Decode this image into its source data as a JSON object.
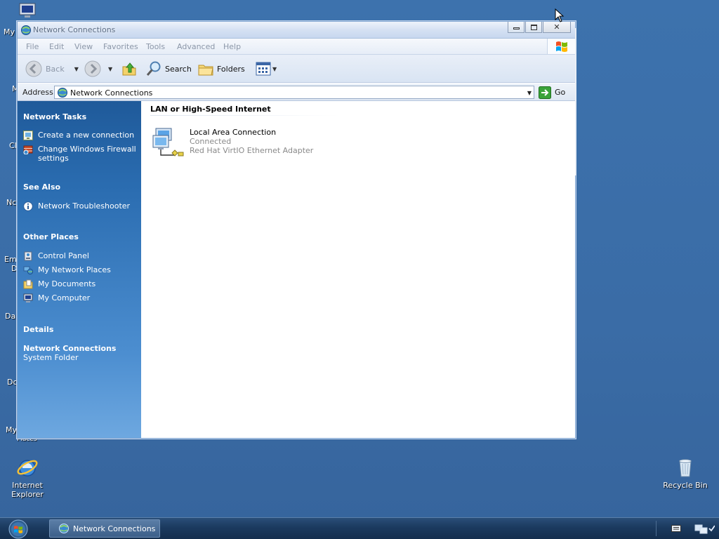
{
  "desktop": {
    "partial_labels": [
      "My",
      "M",
      "Cl",
      "Nc",
      "Em",
      "D",
      "Da",
      "Dc",
      "My",
      "Places"
    ],
    "icons": [
      {
        "label_line1": "Internet",
        "label_line2": "Explorer",
        "icon": "internet-explorer-icon"
      },
      {
        "label_line1": "Recycle Bin",
        "label_line2": "",
        "icon": "recycle-bin-icon"
      }
    ]
  },
  "window": {
    "title": "Network Connections",
    "controls": {
      "minimize": "▭",
      "maximize": "▢",
      "close": "✕"
    },
    "menu": [
      "File",
      "Edit",
      "View",
      "Favorites",
      "Tools",
      "Advanced",
      "Help"
    ],
    "toolbar": {
      "back_label": "Back",
      "search_label": "Search",
      "folders_label": "Folders"
    },
    "address": {
      "label": "Address",
      "value": "Network Connections",
      "go_label": "Go"
    }
  },
  "taskpane": {
    "network_tasks": {
      "heading": "Network Tasks",
      "items": [
        {
          "label": "Create a new connection",
          "icon": "new-connection-icon"
        },
        {
          "label": "Change Windows Firewall settings",
          "icon": "firewall-icon"
        }
      ]
    },
    "see_also": {
      "heading": "See Also",
      "items": [
        {
          "label": "Network Troubleshooter",
          "icon": "info-icon"
        }
      ]
    },
    "other_places": {
      "heading": "Other Places",
      "items": [
        {
          "label": "Control Panel",
          "icon": "control-panel-icon"
        },
        {
          "label": "My Network Places",
          "icon": "network-places-icon"
        },
        {
          "label": "My Documents",
          "icon": "my-documents-icon"
        },
        {
          "label": "My Computer",
          "icon": "my-computer-icon"
        }
      ]
    },
    "details": {
      "heading": "Details",
      "name": "Network Connections",
      "type": "System Folder"
    }
  },
  "content": {
    "group_heading": "LAN or High-Speed Internet",
    "connections": [
      {
        "name": "Local Area Connection",
        "status": "Connected",
        "device": "Red Hat VirtIO Ethernet Adapter",
        "icon": "lan-connection-icon"
      }
    ]
  },
  "taskbar": {
    "task_button_label": "Network Connections"
  },
  "colors": {
    "desktop": "#3a6ea5",
    "taskpane_top": "#1f5a9a",
    "taskpane_bottom": "#6ea8e0",
    "menu_disabled_text": "#8c97a8",
    "status_text": "#8a8a8a"
  }
}
